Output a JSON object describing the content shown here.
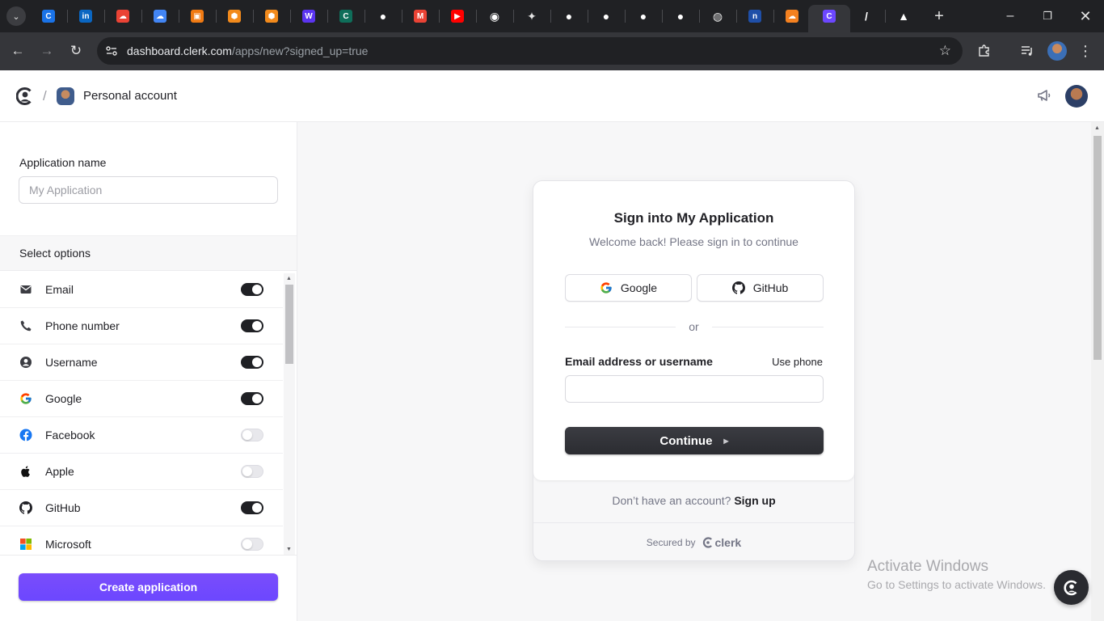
{
  "browser": {
    "tabs": [
      {
        "icon": "clerk-tab-icon",
        "color": "#1a73e8"
      },
      {
        "icon": "linkedin-icon",
        "color": "#0a66c2"
      },
      {
        "icon": "google-cloud-icon",
        "color": "#ea4335"
      },
      {
        "icon": "google-cloud-icon",
        "color": "#4285f4"
      },
      {
        "icon": "orange-square-icon",
        "color": "#f07a13"
      },
      {
        "icon": "orange-hex-icon",
        "color": "#f28a1c"
      },
      {
        "icon": "orange-hex-icon",
        "color": "#f28a1c"
      },
      {
        "icon": "webflow-icon",
        "color": "#5b34f0"
      },
      {
        "icon": "cursor-c-icon",
        "color": "#0f6e5a"
      },
      {
        "icon": "github-icon",
        "color": "#ffffff"
      },
      {
        "icon": "gmail-icon",
        "color": "#ea4335"
      },
      {
        "icon": "youtube-icon",
        "color": "#ff0000"
      },
      {
        "icon": "chat-bot-icon",
        "color": "#ffffff"
      },
      {
        "icon": "sparkle-icon",
        "color": "#e3e3e3"
      },
      {
        "icon": "github-icon",
        "color": "#ffffff"
      },
      {
        "icon": "github-icon",
        "color": "#ffffff"
      },
      {
        "icon": "github-icon",
        "color": "#ffffff"
      },
      {
        "icon": "github-icon",
        "color": "#ffffff"
      },
      {
        "icon": "globe-icon",
        "color": "#e3e3e3"
      },
      {
        "icon": "n-app-icon",
        "color": "#1f4fa8"
      },
      {
        "icon": "cloudflare-icon",
        "color": "#f48120"
      },
      {
        "icon": "clerk-tab-icon",
        "color": "#6c47ff"
      },
      {
        "icon": "slash-app-icon",
        "color": "#ffffff"
      },
      {
        "icon": "vercel-triangle-icon",
        "color": "#ffffff"
      }
    ],
    "url_host": "dashboard.clerk.com",
    "url_path": "/apps/new?signed_up=true"
  },
  "header": {
    "separator": "/",
    "account_name": "Personal account"
  },
  "sidebar": {
    "app_name_label": "Application name",
    "app_name_placeholder": "My Application",
    "app_name_value": "",
    "options_title": "Select options",
    "options": [
      {
        "label": "Email",
        "icon": "mail-icon",
        "enabled": true
      },
      {
        "label": "Phone number",
        "icon": "phone-icon",
        "enabled": true
      },
      {
        "label": "Username",
        "icon": "user-circle-icon",
        "enabled": true
      },
      {
        "label": "Google",
        "icon": "google-icon",
        "enabled": true
      },
      {
        "label": "Facebook",
        "icon": "facebook-icon",
        "enabled": false
      },
      {
        "label": "Apple",
        "icon": "apple-icon",
        "enabled": false
      },
      {
        "label": "GitHub",
        "icon": "github-icon",
        "enabled": true
      },
      {
        "label": "Microsoft",
        "icon": "microsoft-icon",
        "enabled": false
      }
    ],
    "create_button": "Create application"
  },
  "preview": {
    "title": "Sign into My Application",
    "subtitle": "Welcome back! Please sign in to continue",
    "google_button": "Google",
    "github_button": "GitHub",
    "divider": "or",
    "field_label": "Email address or username",
    "use_phone": "Use phone",
    "field_value": "",
    "continue_button": "Continue",
    "no_account": "Don’t have an account?",
    "sign_up": "Sign up",
    "secured_by": "Secured by",
    "clerk_brand": "clerk"
  },
  "watermark": {
    "title": "Activate Windows",
    "subtitle": "Go to Settings to activate Windows."
  },
  "colors": {
    "accent": "#6c47ff",
    "toggle_on": "#1f2024",
    "chrome_dark": "#202124"
  }
}
